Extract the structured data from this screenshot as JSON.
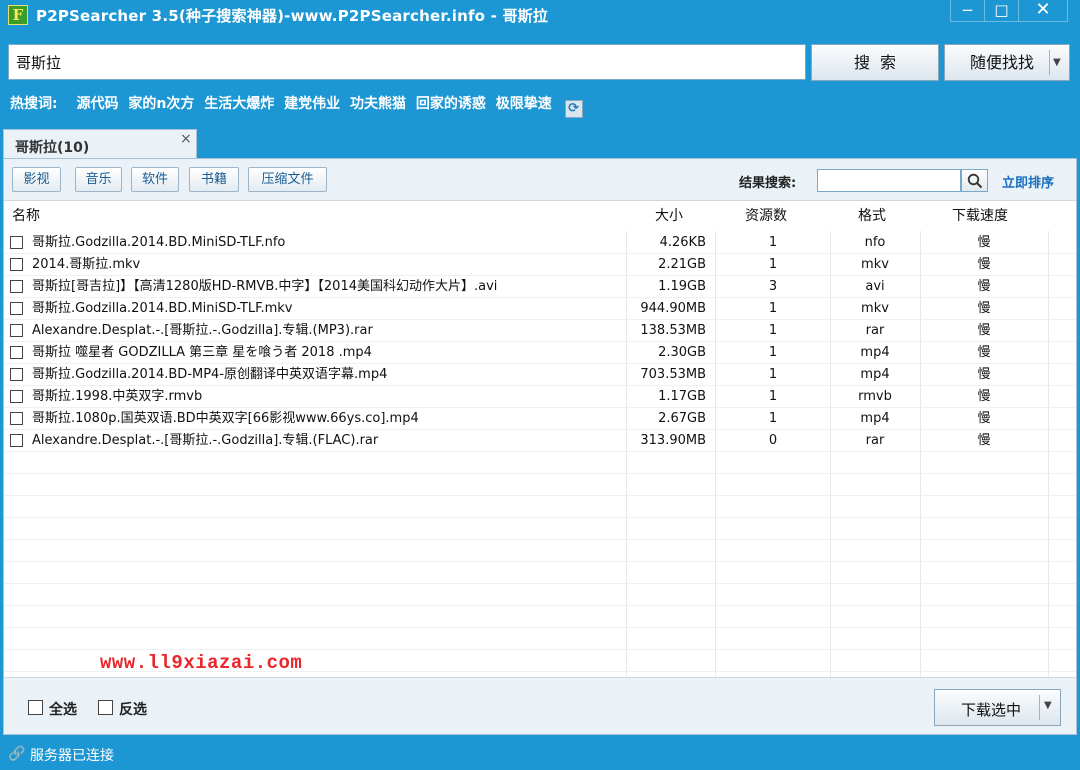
{
  "window": {
    "title": "P2PSearcher 3.5(种子搜索神器)-www.P2PSearcher.info - 哥斯拉",
    "app_icon_letter": "F",
    "minimize": "−",
    "maximize": "□",
    "close": "✕"
  },
  "search": {
    "value": "哥斯拉",
    "button_label": "搜索",
    "random_label": "随便找找"
  },
  "hot": {
    "label": "热搜词:",
    "items": [
      "源代码",
      "家的n次方",
      "生活大爆炸",
      "建党伟业",
      "功夫熊猫",
      "回家的诱惑",
      "极限挚速"
    ]
  },
  "tab": {
    "label": "哥斯拉(10)",
    "close": "×"
  },
  "filters": [
    "影视",
    "音乐",
    "软件",
    "书籍",
    "压缩文件"
  ],
  "result_search": {
    "label": "结果搜索:",
    "value": "",
    "sort_link": "立即排序"
  },
  "table": {
    "headers": {
      "name": "名称",
      "size": "大小",
      "sources": "资源数",
      "format": "格式",
      "speed": "下载速度"
    },
    "rows": [
      {
        "name": "哥斯拉.Godzilla.2014.BD.MiniSD-TLF.nfo",
        "size": "4.26KB",
        "sources": "1",
        "format": "nfo",
        "speed": "慢"
      },
      {
        "name": "2014.哥斯拉.mkv",
        "size": "2.21GB",
        "sources": "1",
        "format": "mkv",
        "speed": "慢"
      },
      {
        "name": "哥斯拉[哥吉拉]】【高清1280版HD-RMVB.中字】【2014美国科幻动作大片】.avi",
        "size": "1.19GB",
        "sources": "3",
        "format": "avi",
        "speed": "慢"
      },
      {
        "name": "哥斯拉.Godzilla.2014.BD.MiniSD-TLF.mkv",
        "size": "944.90MB",
        "sources": "1",
        "format": "mkv",
        "speed": "慢"
      },
      {
        "name": "Alexandre.Desplat.-.[哥斯拉.-.Godzilla].专辑.(MP3).rar",
        "size": "138.53MB",
        "sources": "1",
        "format": "rar",
        "speed": "慢"
      },
      {
        "name": "哥斯拉 噬星者 GODZILLA 第三章 星を喰う者 2018 .mp4",
        "size": "2.30GB",
        "sources": "1",
        "format": "mp4",
        "speed": "慢"
      },
      {
        "name": "哥斯拉.Godzilla.2014.BD-MP4-原创翻译中英双语字幕.mp4",
        "size": "703.53MB",
        "sources": "1",
        "format": "mp4",
        "speed": "慢"
      },
      {
        "name": "哥斯拉.1998.中英双字.rmvb",
        "size": "1.17GB",
        "sources": "1",
        "format": "rmvb",
        "speed": "慢"
      },
      {
        "name": "哥斯拉.1080p.国英双语.BD中英双字[66影视www.66ys.co].mp4",
        "size": "2.67GB",
        "sources": "1",
        "format": "mp4",
        "speed": "慢"
      },
      {
        "name": "Alexandre.Desplat.-.[哥斯拉.-.Godzilla].专辑.(FLAC).rar",
        "size": "313.90MB",
        "sources": "0",
        "format": "rar",
        "speed": "慢"
      }
    ]
  },
  "bottom": {
    "select_all": "全选",
    "invert": "反选",
    "download_label": "下载选中"
  },
  "status": {
    "text": "服务器已连接"
  },
  "watermark": "www.ll9xiazai.com",
  "colors": {
    "chrome": "#1d97d4",
    "panel": "#eaf2f8",
    "link": "#1b6fbf",
    "watermark": "#e8262b"
  }
}
